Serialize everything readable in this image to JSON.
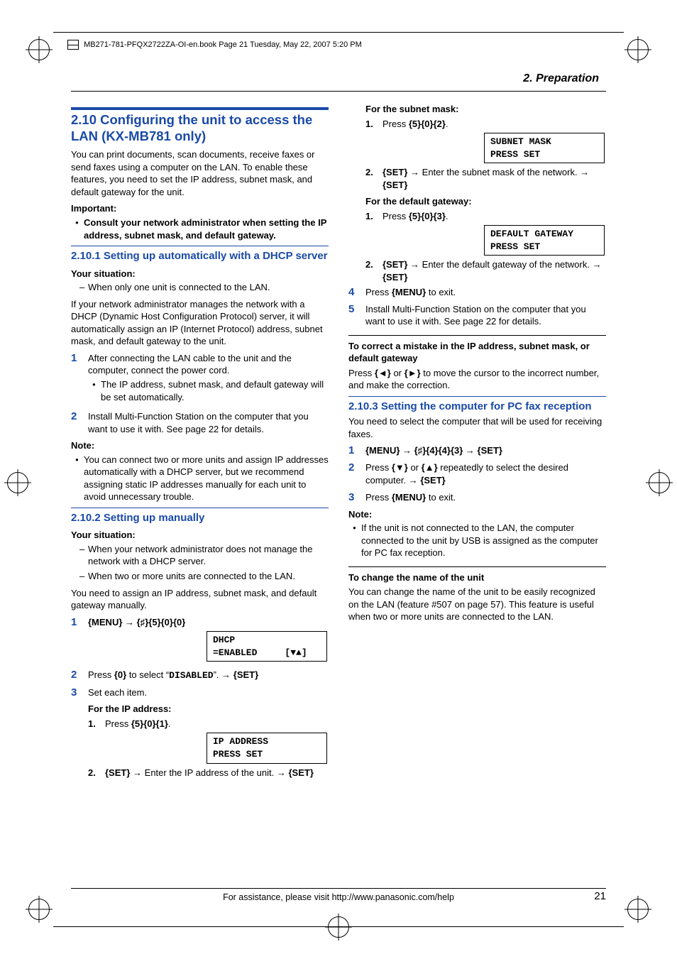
{
  "book_header": "MB271-781-PFQX2722ZA-OI-en.book  Page 21  Tuesday, May 22, 2007  5:20 PM",
  "section_header": "2. Preparation",
  "h2": "2.10 Configuring the unit to access the LAN (KX-MB781 only)",
  "intro": "You can print documents, scan documents, receive faxes or send faxes using a computer on the LAN. To enable these features, you need to set the IP address, subnet mask, and default gateway for the unit.",
  "important_label": "Important:",
  "important_bullet": "Consult your network administrator when setting the IP address, subnet mask, and default gateway.",
  "s1_title": "2.10.1 Setting up automatically with a DHCP server",
  "s1_sit_label": "Your situation:",
  "s1_sit_dash": "When only one unit is connected to the LAN.",
  "s1_p1": "If your network administrator manages the network with a DHCP (Dynamic Host Configuration Protocol) server, it will automatically assign an IP (Internet Protocol) address, subnet mask, and default gateway to the unit.",
  "s1_step1": "After connecting the LAN cable to the unit and the computer, connect the power cord.",
  "s1_step1_sub": "The IP address, subnet mask, and default gateway will be set automatically.",
  "s1_step2": "Install Multi-Function Station on the computer that you want to use it with. See page 22 for details.",
  "s1_note_label": "Note:",
  "s1_note_bullet": "You can connect two or more units and assign IP addresses automatically with a DHCP server, but we recommend assigning static IP addresses manually for each unit to avoid unnecessary trouble.",
  "s2_title": "2.10.2 Setting up manually",
  "s2_sit_label": "Your situation:",
  "s2_sit_d1": "When your network administrator does not manage the network with a DHCP server.",
  "s2_sit_d2": "When two or more units are connected to the LAN.",
  "s2_p1": "You need to assign an IP address, subnet mask, and default gateway manually.",
  "s2_step1_keys_a": "{MENU}",
  "s2_step1_keys_b": "{♯}{5}{0}{0}",
  "s2_disp1_l1": "DHCP",
  "s2_disp1_l2": "=ENABLED     [▼▲]",
  "s2_step2_a": "Press ",
  "s2_step2_b": "{0}",
  "s2_step2_c": " to select “",
  "s2_step2_d": "DISABLED",
  "s2_step2_e": "”. ",
  "s2_step2_f": "{SET}",
  "s2_step3": "Set each item.",
  "s2_ip_label": "For the IP address:",
  "s2_ip_s1": "Press ",
  "s2_ip_s1_k": "{5}{0}{1}",
  "s2_disp2_l1": "IP ADDRESS",
  "s2_disp2_l2": "PRESS SET",
  "s2_ip_s2_a": "{SET}",
  "s2_ip_s2_b": " Enter the IP address of the unit. ",
  "s2_ip_s2_c": "{SET}",
  "s2_sm_label": "For the subnet mask:",
  "s2_sm_s1": "Press ",
  "s2_sm_s1_k": "{5}{0}{2}",
  "s2_disp3_l1": "SUBNET MASK",
  "s2_disp3_l2": "PRESS SET",
  "s2_sm_s2_a": "{SET}",
  "s2_sm_s2_b": " Enter the subnet mask of the network. ",
  "s2_sm_s2_c": "{SET}",
  "s2_gw_label": "For the default gateway:",
  "s2_gw_s1": "Press ",
  "s2_gw_s1_k": "{5}{0}{3}",
  "s2_disp4_l1": "DEFAULT GATEWAY",
  "s2_disp4_l2": "PRESS SET",
  "s2_gw_s2_a": "{SET}",
  "s2_gw_s2_b": " Enter the default gateway of the network. ",
  "s2_gw_s2_c": "{SET}",
  "s2_step4_a": "Press ",
  "s2_step4_b": "{MENU}",
  "s2_step4_c": " to exit.",
  "s2_step5": "Install Multi-Function Station on the computer that you want to use it with. See page 22 for details.",
  "s2_correct_label": "To correct a mistake in the IP address, subnet mask, or default gateway",
  "s2_correct_p_a": "Press ",
  "s2_correct_p_b": "{◄}",
  "s2_correct_p_c": " or ",
  "s2_correct_p_d": "{►}",
  "s2_correct_p_e": " to move the cursor to the incorrect number, and make the correction.",
  "s3_title": "2.10.3 Setting the computer for PC fax reception",
  "s3_p1": "You need to select the computer that will be used for receiving faxes.",
  "s3_step1_a": "{MENU}",
  "s3_step1_b": "{♯}{4}{4}{3}",
  "s3_step1_c": "{SET}",
  "s3_step2_a": "Press ",
  "s3_step2_b": "{▼}",
  "s3_step2_c": " or ",
  "s3_step2_d": "{▲}",
  "s3_step2_e": " repeatedly to select the desired computer. ",
  "s3_step2_f": "{SET}",
  "s3_step3_a": "Press ",
  "s3_step3_b": "{MENU}",
  "s3_step3_c": " to exit.",
  "s3_note_label": "Note:",
  "s3_note_bullet": "If the unit is not connected to the LAN, the computer connected to the unit by USB is assigned as the computer for PC fax reception.",
  "s3_change_label": "To change the name of the unit",
  "s3_change_p": "You can change the name of the unit to be easily recognized on the LAN (feature #507 on page 57). This feature is useful when two or more units are connected to the LAN.",
  "footer": "For assistance, please visit http://www.panasonic.com/help",
  "page_num": "21"
}
